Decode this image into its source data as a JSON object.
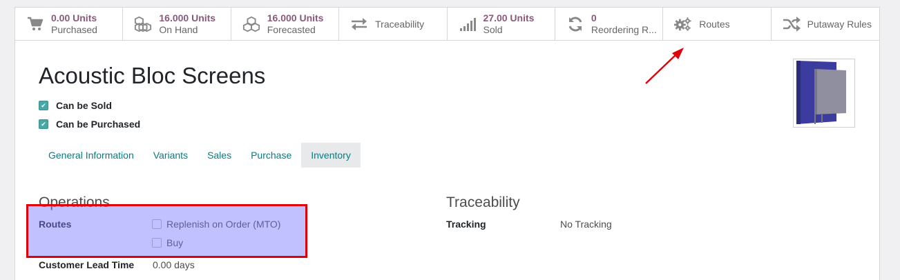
{
  "stat_buttons": [
    {
      "value": "0.00 Units",
      "label": "Purchased",
      "icon": "cart-icon"
    },
    {
      "value": "16.000 Units",
      "label": "On Hand",
      "icon": "cubes-icon"
    },
    {
      "value": "16.000 Units",
      "label": "Forecasted",
      "icon": "cubes-icon"
    },
    {
      "label": "Traceability",
      "icon": "exchange-arrows-icon"
    },
    {
      "value": "27.00 Units",
      "label": "Sold",
      "icon": "signal-bars-icon"
    },
    {
      "value": "0",
      "label": "Reordering R...",
      "icon": "refresh-icon"
    },
    {
      "label": "Routes",
      "icon": "gears-icon"
    },
    {
      "label": "Putaway Rules",
      "icon": "shuffle-icon"
    }
  ],
  "product": {
    "name": "Acoustic Bloc Screens",
    "can_be_sold": "Can be Sold",
    "can_be_purchased": "Can be Purchased"
  },
  "tabs": [
    "General Information",
    "Variants",
    "Sales",
    "Purchase",
    "Inventory"
  ],
  "active_tab": "Inventory",
  "operations": {
    "heading": "Operations",
    "routes_label": "Routes",
    "routes": [
      "Replenish on Order (MTO)",
      "Buy"
    ],
    "lead_time_label": "Customer Lead Time",
    "lead_time_value": "0.00 days"
  },
  "traceability": {
    "heading": "Traceability",
    "tracking_label": "Tracking",
    "tracking_value": "No Tracking"
  },
  "colors": {
    "accent": "#875a7b",
    "link": "#017e84",
    "checkbox": "#45a9a5",
    "annotation": "#e0000a"
  }
}
